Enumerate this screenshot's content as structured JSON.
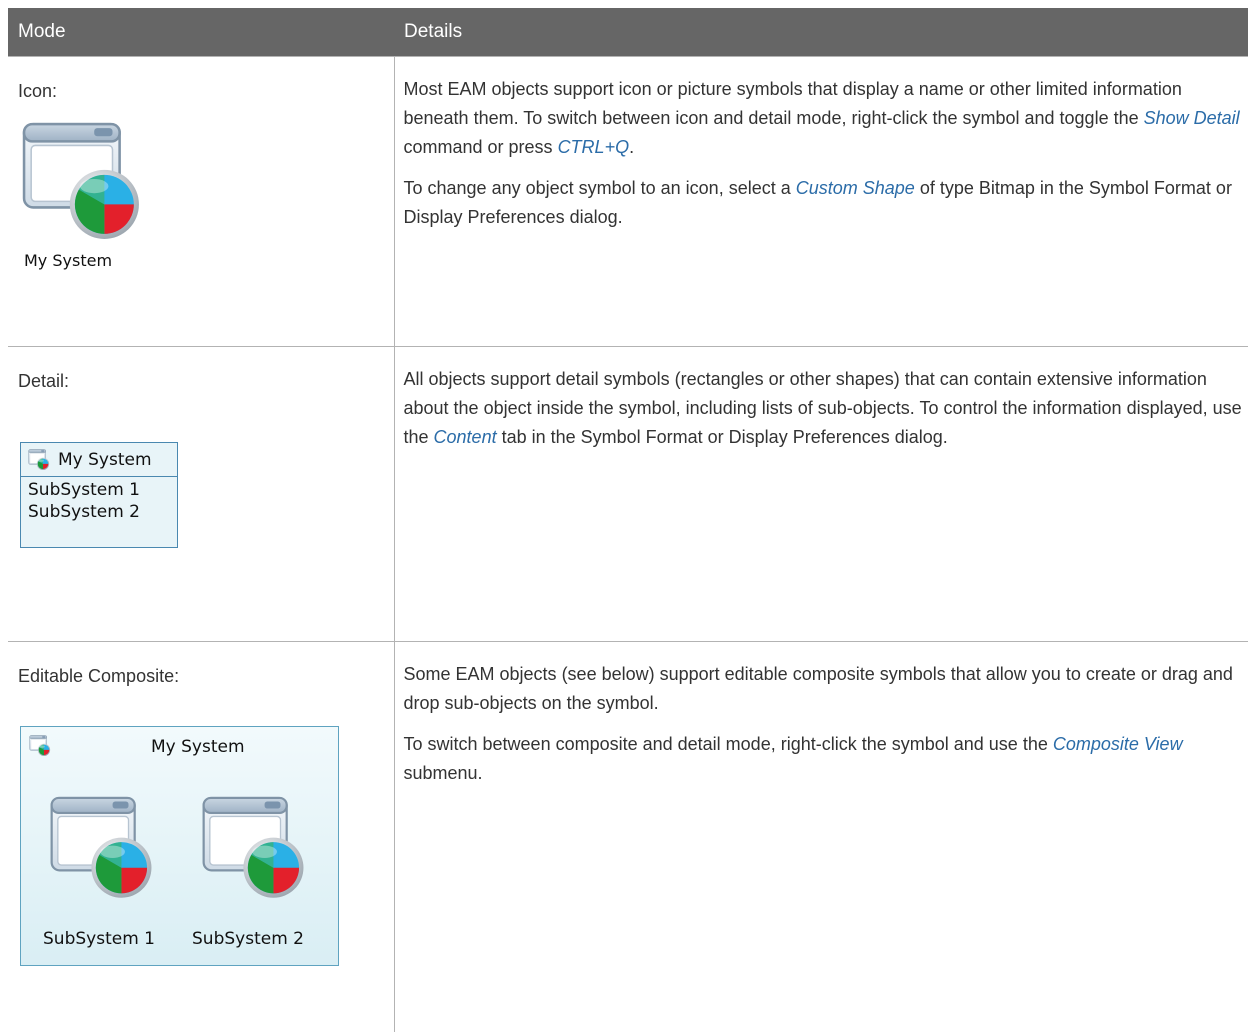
{
  "table": {
    "headers": [
      "Mode",
      "Details"
    ]
  },
  "rows": {
    "icon": {
      "mode_label": "Icon:",
      "symbol_name": "My System",
      "p1_a": "Most EAM objects support icon or picture symbols that display a name or other limited information beneath them. To switch between icon and detail mode, right-click the symbol and toggle the ",
      "p1_term1": "Show Detail",
      "p1_b": " command or press ",
      "p1_term2": "CTRL+Q",
      "p1_c": ".",
      "p2_a": "To change any object symbol to an icon, select a ",
      "p2_term": "Custom Shape",
      "p2_b": " of type Bitmap in the Symbol Format or Display Preferences dialog."
    },
    "detail": {
      "mode_label": "Detail:",
      "symbol_name": "My System",
      "sub1": "SubSystem 1",
      "sub2": "SubSystem 2",
      "p1_a": "All objects support detail symbols (rectangles or other shapes) that can contain exten­sive information about the object inside the symbol, including lists of sub-objects. To control the information displayed, use the ",
      "p1_term": "Content",
      "p1_b": " tab in the Symbol Format or Display Preferences dialog."
    },
    "composite": {
      "mode_label": "Editable Composite:",
      "symbol_name": "My System",
      "sub1": "SubSystem 1",
      "sub2": "SubSystem 2",
      "p1": "Some EAM objects (see below) support editable composite symbols that allow you to create or drag and drop sub-objects on the symbol.",
      "p2_a": "To switch between composite and detail mode, right-click the symbol and use the ",
      "p2_term": "Composite View",
      "p2_b": " submenu."
    }
  },
  "colors": {
    "header_bg": "#666666",
    "link_term": "#2b6ca8",
    "pie_blue": "#3bb8e8",
    "pie_green": "#1e9a3a",
    "pie_red": "#e0202a"
  },
  "icons": [
    "system-window-pie-icon",
    "system-mini-icon"
  ]
}
